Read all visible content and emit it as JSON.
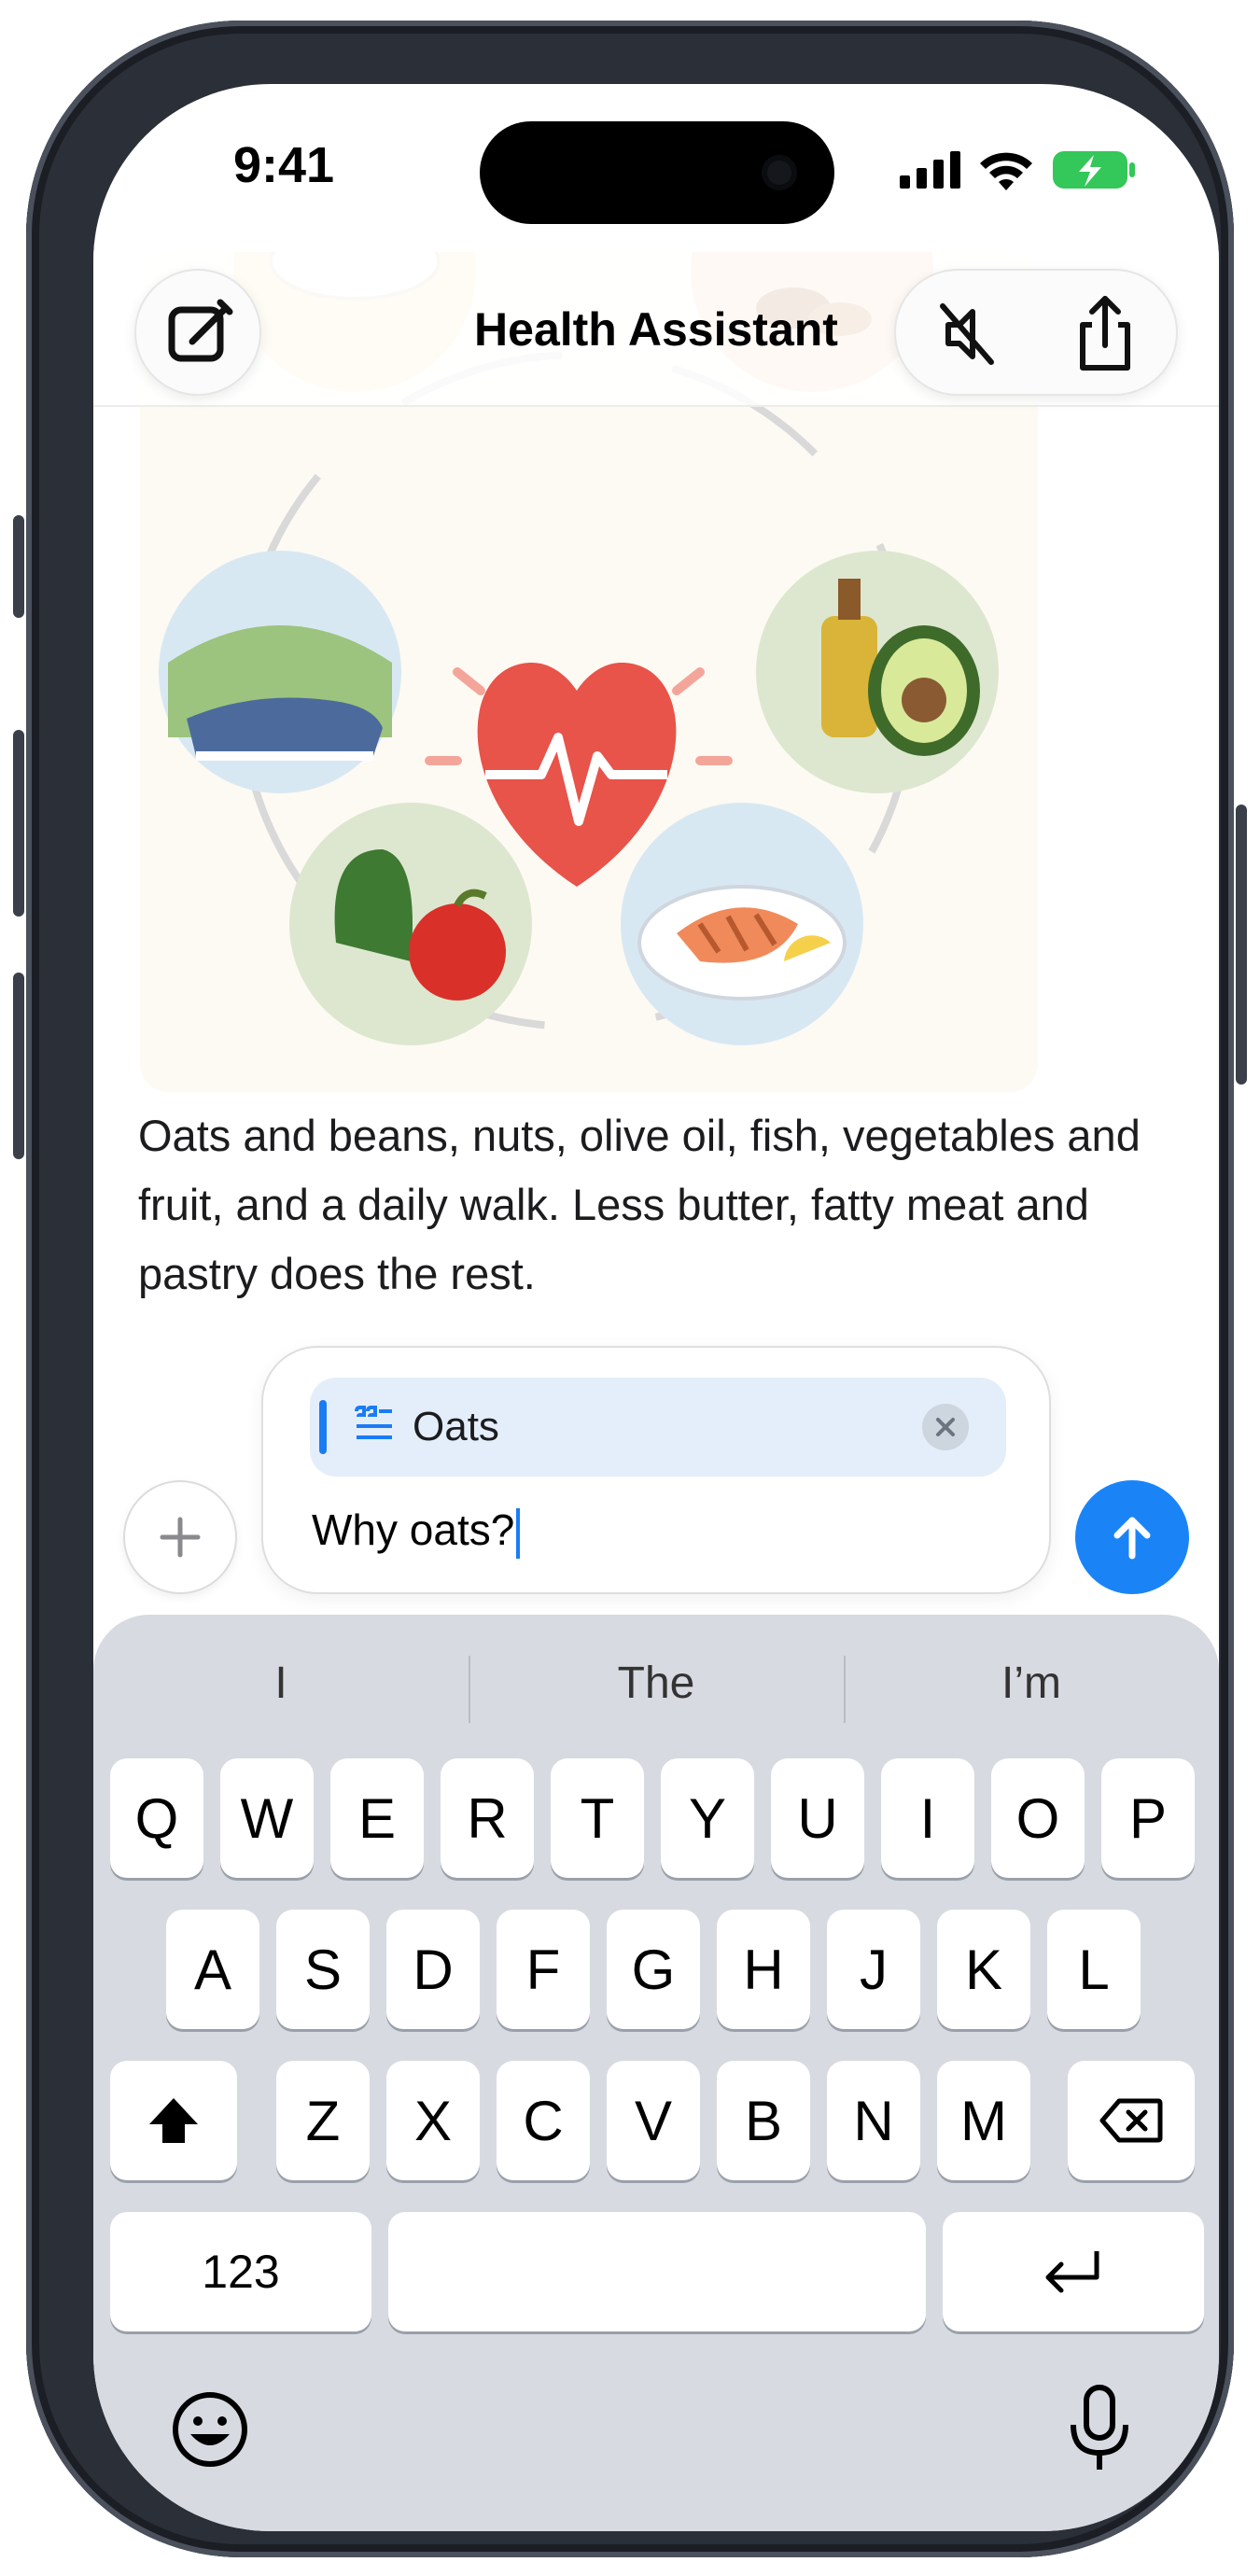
{
  "status_bar": {
    "time": "9:41"
  },
  "header": {
    "title": "Health Assistant"
  },
  "message": {
    "text": "Oats and beans, nuts, olive oil, fish, vegetables and fruit, and a daily walk. Less butter, fatty meat and pastry does the rest."
  },
  "composer": {
    "quote_chip_label": "Oats",
    "input_value": "Why oats?"
  },
  "keyboard": {
    "suggestions": [
      "I",
      "The",
      "I’m"
    ],
    "row1": [
      "Q",
      "W",
      "E",
      "R",
      "T",
      "Y",
      "U",
      "I",
      "O",
      "P"
    ],
    "row2": [
      "A",
      "S",
      "D",
      "F",
      "G",
      "H",
      "J",
      "K",
      "L"
    ],
    "row3": [
      "Z",
      "X",
      "C",
      "V",
      "B",
      "N",
      "M"
    ],
    "numbers_key": "123"
  },
  "colors": {
    "accent": "#1a84f7",
    "battery": "#34c759",
    "keyboard_bg": "#d7dae1"
  }
}
